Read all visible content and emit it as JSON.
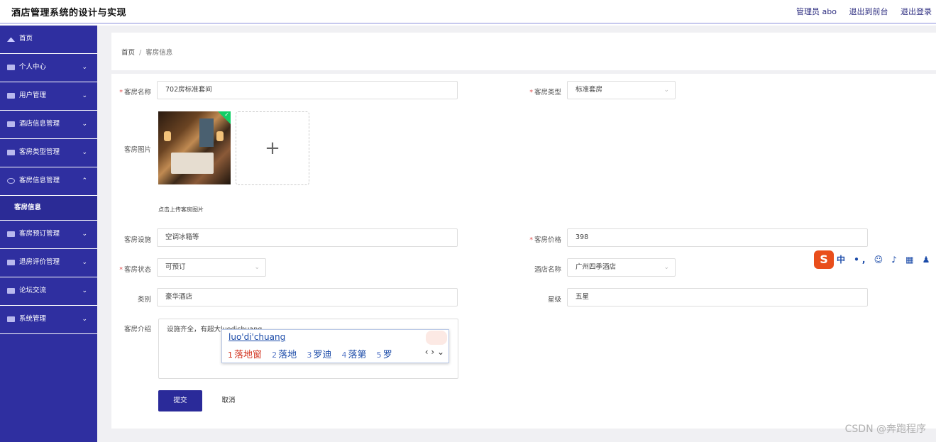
{
  "header": {
    "title": "酒店管理系统的设计与实现",
    "user": "管理员 abo",
    "to_front": "退出到前台",
    "logout": "退出登录"
  },
  "sidebar": {
    "items": [
      {
        "label": "首页",
        "icon": "home-icon"
      },
      {
        "label": "个人中心",
        "icon": "user-icon",
        "caret": "⌄"
      },
      {
        "label": "用户管理",
        "icon": "list-icon",
        "caret": "⌄"
      },
      {
        "label": "酒店信息管理",
        "icon": "hotel-icon",
        "caret": "⌄"
      },
      {
        "label": "客房类型管理",
        "icon": "flag-icon",
        "caret": "⌄"
      },
      {
        "label": "客房信息管理",
        "icon": "info-icon",
        "caret": "⌃"
      },
      {
        "label": "客房信息",
        "sub": true
      },
      {
        "label": "客房预订管理",
        "icon": "copy-icon",
        "caret": "⌄"
      },
      {
        "label": "退房评价管理",
        "icon": "comment-icon",
        "caret": "⌄"
      },
      {
        "label": "论坛交流",
        "icon": "forum-icon",
        "caret": "⌄"
      },
      {
        "label": "系统管理",
        "icon": "settings-icon",
        "caret": "⌄"
      }
    ]
  },
  "breadcrumb": {
    "home": "首页",
    "sep": "/",
    "current": "客房信息"
  },
  "form": {
    "room_name": {
      "label": "客房名称",
      "value": "702房标准套间"
    },
    "room_type": {
      "label": "客房类型",
      "value": "标准套房"
    },
    "room_image": {
      "label": "客房图片",
      "tip": "点击上传客房图片",
      "plus": "+"
    },
    "facilities": {
      "label": "客房设施",
      "value": "空调冰箱等"
    },
    "price": {
      "label": "客房价格",
      "value": "398"
    },
    "status": {
      "label": "客房状态",
      "value": "可预订"
    },
    "hotel_name": {
      "label": "酒店名称",
      "value": "广州四季酒店"
    },
    "category": {
      "label": "类别",
      "value": "豪华酒店"
    },
    "stars": {
      "label": "星级",
      "value": "五星"
    },
    "intro": {
      "label": "客房介绍",
      "value": "设施齐全，有超大luodichuang"
    },
    "submit": "提交",
    "cancel": "取消"
  },
  "ime": {
    "input": "luo'di'chuang",
    "candidates": [
      {
        "n": "1",
        "text": "落地窗"
      },
      {
        "n": "2",
        "text": "落地"
      },
      {
        "n": "3",
        "text": "罗迪"
      },
      {
        "n": "4",
        "text": "落第"
      },
      {
        "n": "5",
        "text": "罗"
      }
    ],
    "nav": "‹ › ⌄",
    "toolbar_logo": "S",
    "toolbar_text": "中 •, ☺ ♪ ▦ ♟ ☗"
  },
  "watermark": "CSDN @奔跑程序",
  "colors": {
    "sidebar": "#2f2fa0",
    "primary": "#2a2a99",
    "required": "#e25050"
  }
}
